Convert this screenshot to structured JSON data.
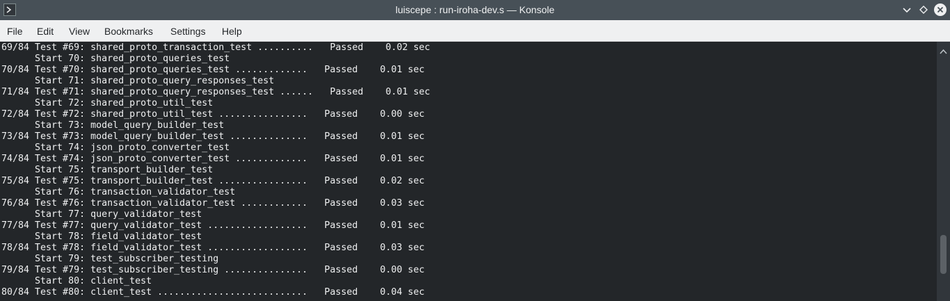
{
  "window": {
    "title": "luiscepe : run-iroha-dev.s — Konsole",
    "app_icon": "terminal-icon",
    "controls": [
      "minimize-icon",
      "maximize-icon",
      "close-icon"
    ]
  },
  "menubar": {
    "items": [
      {
        "label": "File"
      },
      {
        "label": "Edit"
      },
      {
        "label": "View"
      },
      {
        "label": "Bookmarks"
      },
      {
        "label": "Settings"
      },
      {
        "label": "Help"
      }
    ]
  },
  "terminal": {
    "lines": [
      {
        "text": "69/84 Test #69: shared_proto_transaction_test ..........   Passed    0.02 sec"
      },
      {
        "text": "      Start 70: shared_proto_queries_test"
      },
      {
        "text": "70/84 Test #70: shared_proto_queries_test .............   Passed    0.01 sec"
      },
      {
        "text": "      Start 71: shared_proto_query_responses_test"
      },
      {
        "text": "71/84 Test #71: shared_proto_query_responses_test ......   Passed    0.01 sec"
      },
      {
        "text": "      Start 72: shared_proto_util_test"
      },
      {
        "text": "72/84 Test #72: shared_proto_util_test ................   Passed    0.00 sec"
      },
      {
        "text": "      Start 73: model_query_builder_test"
      },
      {
        "text": "73/84 Test #73: model_query_builder_test ..............   Passed    0.01 sec"
      },
      {
        "text": "      Start 74: json_proto_converter_test"
      },
      {
        "text": "74/84 Test #74: json_proto_converter_test .............   Passed    0.01 sec"
      },
      {
        "text": "      Start 75: transport_builder_test"
      },
      {
        "text": "75/84 Test #75: transport_builder_test ................   Passed    0.02 sec"
      },
      {
        "text": "      Start 76: transaction_validator_test"
      },
      {
        "text": "76/84 Test #76: transaction_validator_test ............   Passed    0.03 sec"
      },
      {
        "text": "      Start 77: query_validator_test"
      },
      {
        "text": "77/84 Test #77: query_validator_test ..................   Passed    0.01 sec"
      },
      {
        "text": "      Start 78: field_validator_test"
      },
      {
        "text": "78/84 Test #78: field_validator_test ..................   Passed    0.03 sec"
      },
      {
        "text": "      Start 79: test_subscriber_testing"
      },
      {
        "text": "79/84 Test #79: test_subscriber_testing ...............   Passed    0.00 sec"
      },
      {
        "text": "      Start 80: client_test"
      },
      {
        "text": "80/84 Test #80: client_test ...........................   Passed    0.04 sec"
      }
    ]
  },
  "scrollbar": {
    "up_icon": "scroll-up-arrow-icon",
    "position_fraction": 0.88
  },
  "colors": {
    "titlebar": "#475057",
    "terminal_bg": "#232629",
    "terminal_fg": "#eff0f1",
    "menubar_bg": "#eff0f1",
    "close_button": "#eff0f1"
  }
}
